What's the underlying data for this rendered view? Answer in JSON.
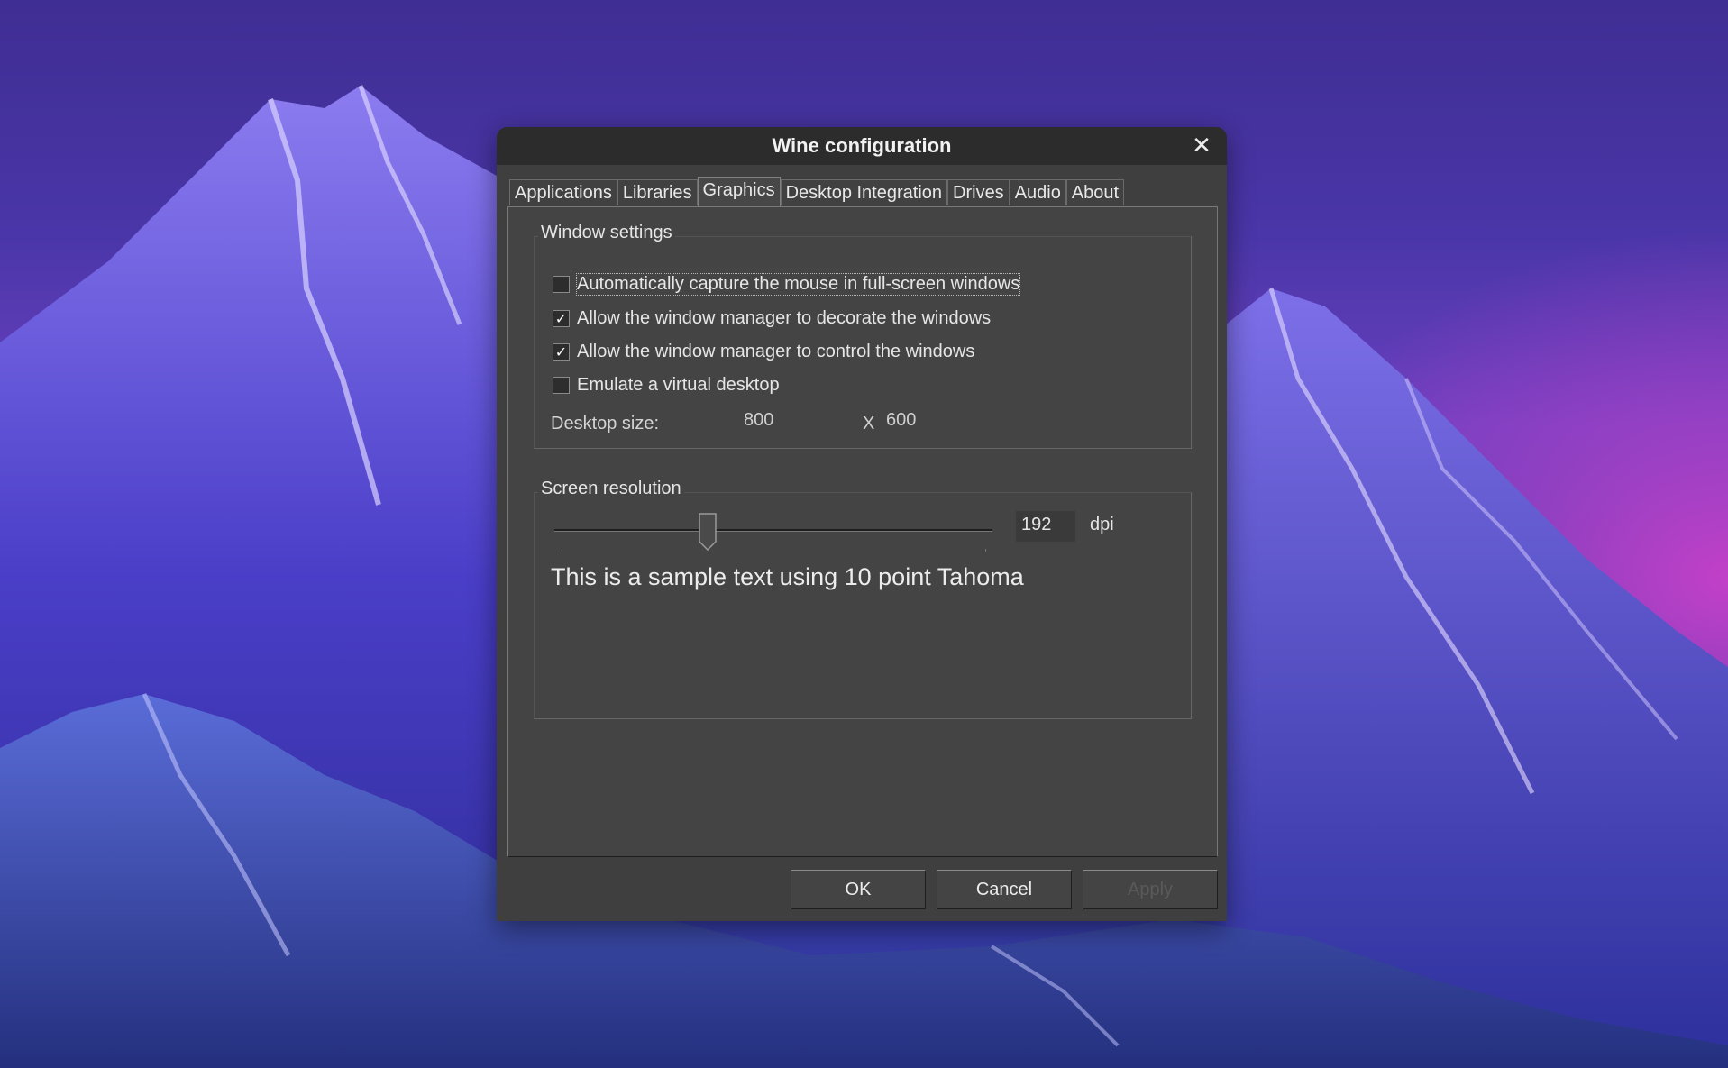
{
  "window": {
    "title": "Wine configuration",
    "close_glyph": "✕"
  },
  "tabs": [
    {
      "label": "Applications",
      "active": false
    },
    {
      "label": "Libraries",
      "active": false
    },
    {
      "label": "Graphics",
      "active": true
    },
    {
      "label": "Desktop Integration",
      "active": false
    },
    {
      "label": "Drives",
      "active": false
    },
    {
      "label": "Audio",
      "active": false
    },
    {
      "label": "About",
      "active": false
    }
  ],
  "window_settings": {
    "label": "Window settings",
    "options": [
      {
        "label": "Automatically capture the mouse in full-screen windows",
        "checked": false
      },
      {
        "label": "Allow the window manager to decorate the windows",
        "checked": true
      },
      {
        "label": "Allow the window manager to control the windows",
        "checked": true
      },
      {
        "label": "Emulate a virtual desktop",
        "checked": false
      }
    ],
    "desktop_size_label": "Desktop size:",
    "width_value": "800",
    "separator": "X",
    "height_value": "600"
  },
  "screen_resolution": {
    "label": "Screen resolution",
    "dpi_value": "192",
    "dpi_unit": "dpi",
    "slider_fraction": 0.35,
    "sample_text": "This is a sample text using 10 point Tahoma"
  },
  "buttons": {
    "ok": "OK",
    "cancel": "Cancel",
    "apply": "Apply"
  },
  "colors": {
    "window_bg": "#3f3f3f",
    "titlebar_bg": "#2c2c2c",
    "text": "#e6e6e6"
  }
}
